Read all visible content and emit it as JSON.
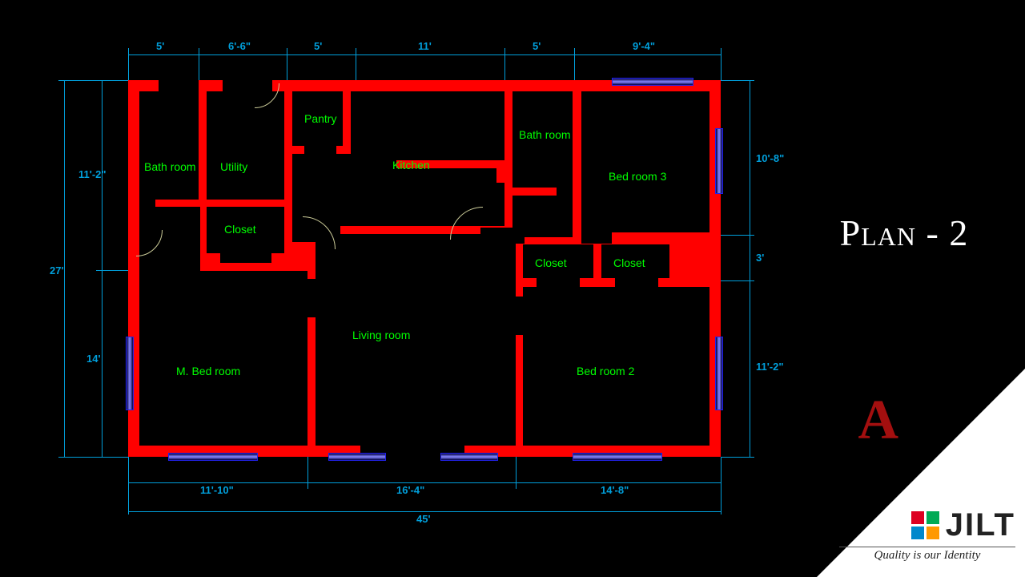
{
  "title": "Plan - 2",
  "brand": {
    "logo_letter": "A",
    "name": "JILT",
    "tagline": "Quality is our Identity"
  },
  "rooms": {
    "bathroom1": "Bath room",
    "utility": "Utility",
    "pantry": "Pantry",
    "kitchen": "Kitchen",
    "bathroom2": "Bath room",
    "bedroom3": "Bed room 3",
    "closet1": "Closet",
    "closet2": "Closet",
    "closet3": "Closet",
    "living": "Living room",
    "master": "M. Bed room",
    "bedroom2": "Bed room 2"
  },
  "dimensions_top": [
    "5'",
    "6'-6\"",
    "5'",
    "11'",
    "5'",
    "9'-4\""
  ],
  "dimensions_bottom_inner": [
    "11'-10\"",
    "16'-4\"",
    "14'-8\""
  ],
  "dimensions_bottom_outer": "45'",
  "dimensions_left_inner": [
    "11'-2\"",
    "14'"
  ],
  "dimensions_left_outer": "27'",
  "dimensions_right": [
    "10'-8\"",
    "3'",
    "11'-2\""
  ]
}
